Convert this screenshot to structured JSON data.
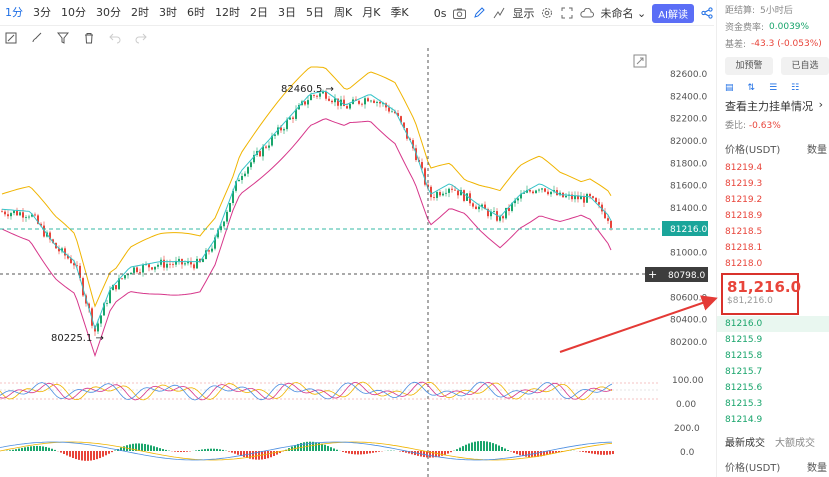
{
  "toolbar": {
    "timeframes": [
      "1分",
      "3分",
      "10分",
      "30分",
      "2时",
      "3时",
      "6时",
      "12时",
      "2日",
      "3日",
      "5日",
      "周K",
      "月K",
      "季K"
    ],
    "active_timeframe": "1分",
    "seconds": "0s",
    "display_label": "显示",
    "template_label": "未命名",
    "ai_label": "AI解读"
  },
  "chart": {
    "price_ticks": [
      "82600.0",
      "82400.0",
      "82200.0",
      "82000.0",
      "81800.0",
      "81600.0",
      "81400.0",
      "81200.0",
      "81000.0",
      "80800.0",
      "80600.0",
      "80400.0",
      "80200.0"
    ],
    "current_price_tag": "81216.0",
    "cursor_price_tag": "80798.0",
    "high_label": "82460.5 →",
    "low_label": "80225.1 →",
    "osc_ticks": [
      "100.00",
      "0.00"
    ],
    "macd_ticks": [
      "200.0",
      "0.0"
    ],
    "colors": {
      "up": "#1aa56b",
      "down": "#e8443a",
      "boll_upper": "#f0b400",
      "boll_mid": "#35c3c8",
      "boll_lower": "#d6368a",
      "cursor_box": "#3d3d3d"
    }
  },
  "panel": {
    "settlement_label": "距结算:",
    "settlement_value": "5小时后",
    "funding_label": "资金费率:",
    "funding_value": "0.0039%",
    "basis_label": "基差:",
    "basis_value": "-43.3 (-0.053%)",
    "alert_btn": "加预警",
    "watch_btn": "已自选",
    "depth_link": "查看主力挂单情况",
    "wei_label": "委比:",
    "wei_value": "-0.63%",
    "ob_price_header": "价格(USDT)",
    "ob_qty_header": "数量",
    "asks": [
      "81219.4",
      "81219.3",
      "81219.2",
      "81218.9",
      "81218.5",
      "81218.1",
      "81218.0"
    ],
    "last_price": "81,216.0",
    "last_price_usd": "$81,216.0",
    "bids": [
      "81216.0",
      "81215.9",
      "81215.8",
      "81215.7",
      "81215.6",
      "81215.3",
      "81214.9"
    ],
    "trades_tab_latest": "最新成交",
    "trades_tab_large": "大额成交",
    "trades_price_header": "价格(USDT)",
    "trades_qty_header": "数量"
  }
}
